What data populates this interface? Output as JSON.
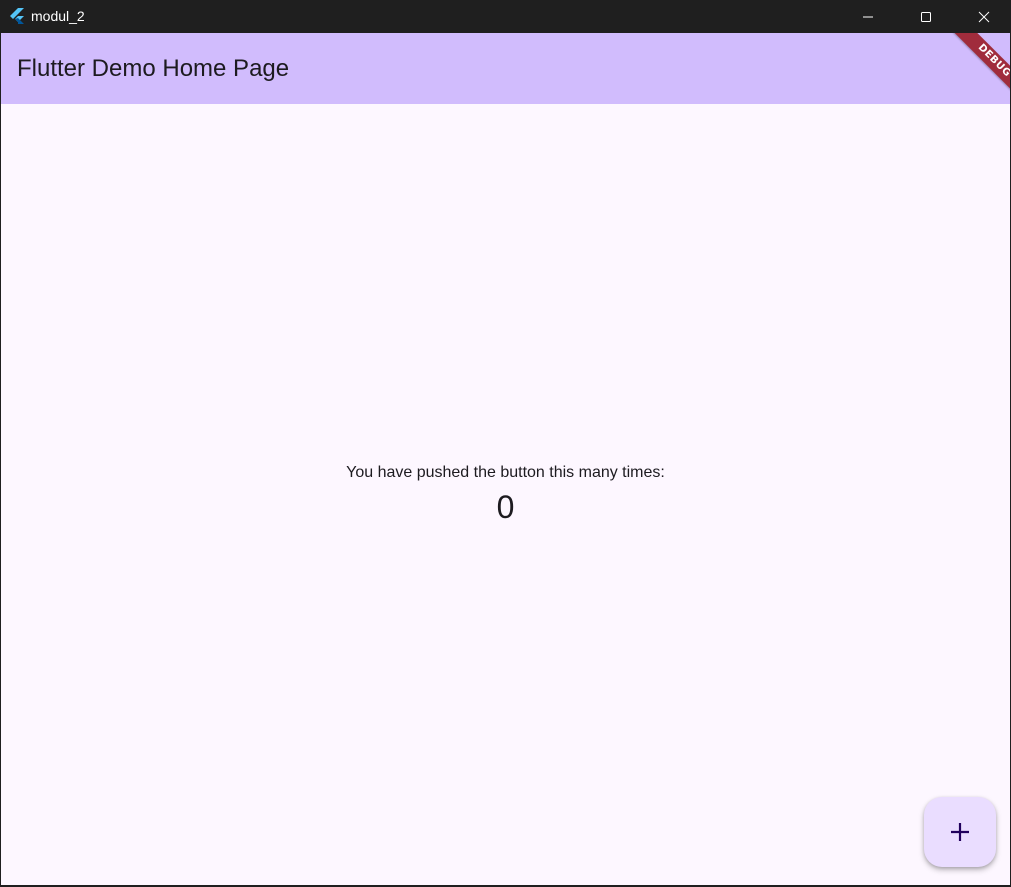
{
  "window": {
    "title": "modul_2",
    "icon": "flutter-logo-icon",
    "controls": {
      "minimize_icon": "minimize-icon",
      "maximize_icon": "maximize-icon",
      "close_icon": "close-icon"
    }
  },
  "appbar": {
    "title": "Flutter Demo Home Page",
    "background": "#d1bcfd"
  },
  "debug_banner": {
    "label": "DEBUG",
    "color": "#a02c3c"
  },
  "body": {
    "message": "You have pushed the button this many times:",
    "counter": "0",
    "background": "#fdf7ff"
  },
  "fab": {
    "icon": "plus-icon",
    "background": "#eaddff"
  }
}
